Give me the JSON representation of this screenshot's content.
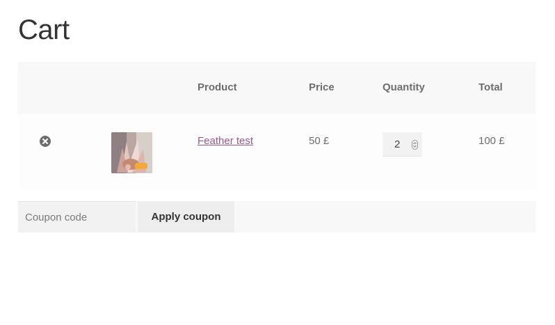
{
  "page": {
    "title": "Cart"
  },
  "table": {
    "headers": {
      "product": "Product",
      "price": "Price",
      "quantity": "Quantity",
      "total": "Total"
    },
    "rows": [
      {
        "product_name": "Feather test",
        "price": "50 £",
        "quantity": "2",
        "total": "100 £"
      }
    ]
  },
  "coupon": {
    "placeholder": "Coupon code",
    "apply_label": "Apply coupon"
  },
  "colors": {
    "link": "#96588a",
    "header_bg": "#f8f8f8",
    "remove_icon": "#6d6d6d"
  },
  "icons": {
    "remove": "remove-circle-icon",
    "spinner": "number-spinner-icon"
  }
}
